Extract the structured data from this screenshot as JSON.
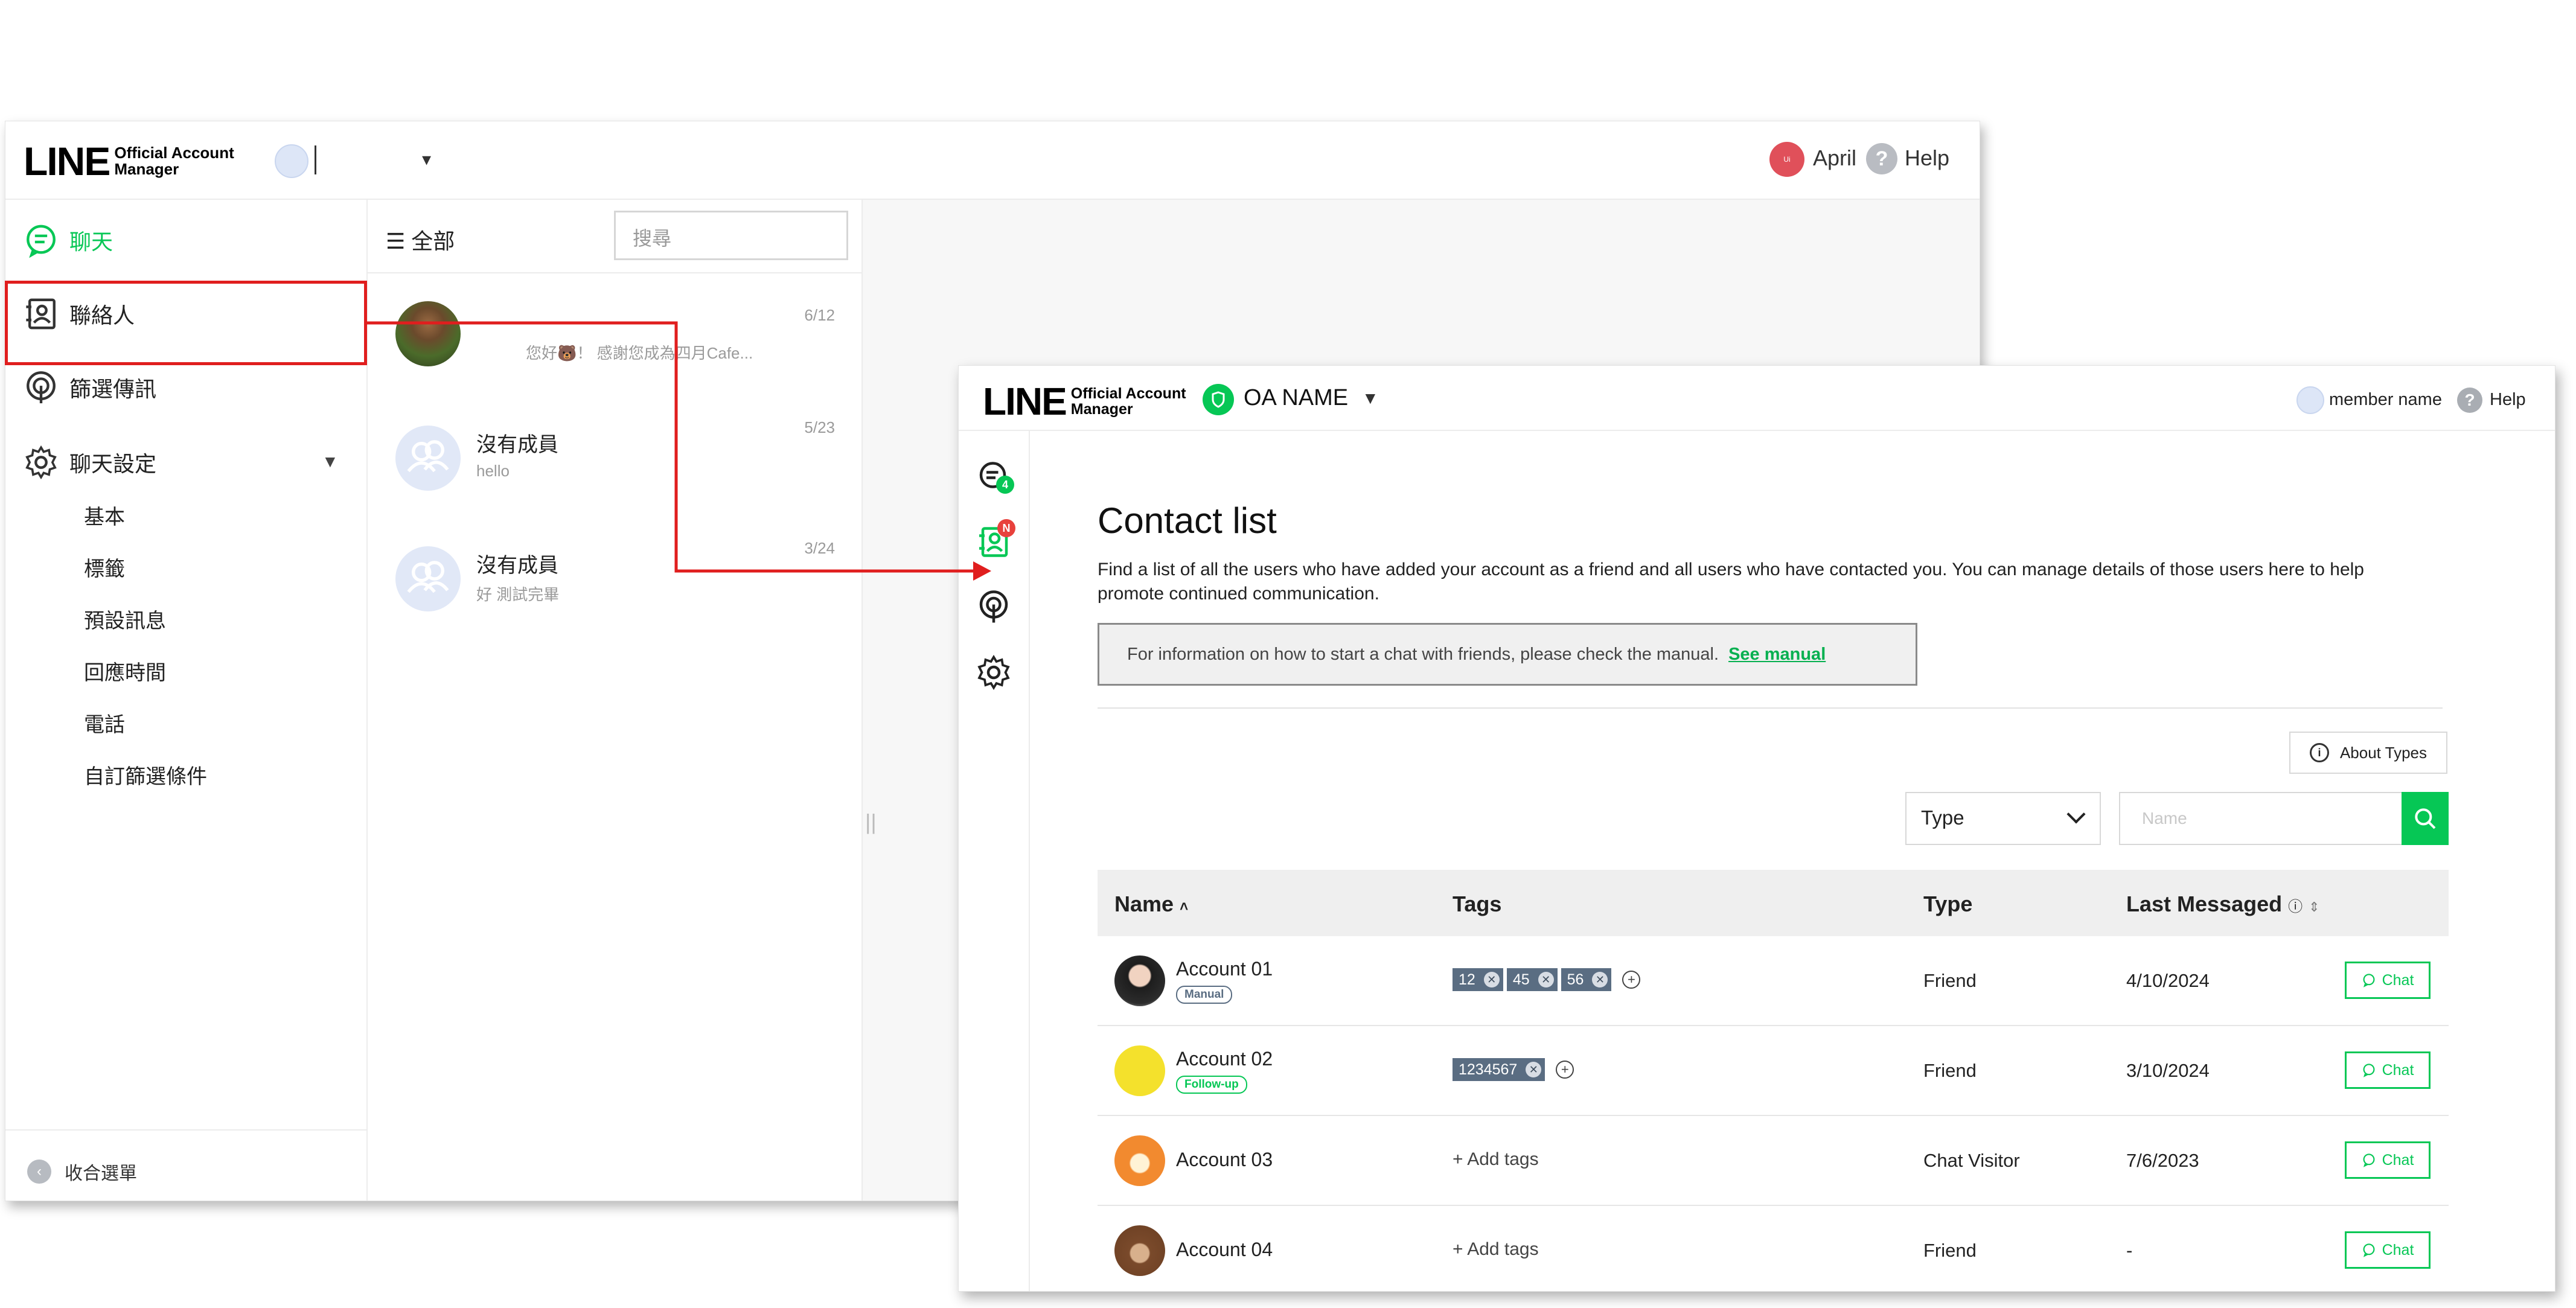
{
  "window1": {
    "logo": {
      "line": "LINE",
      "sub1": "Official Account",
      "sub2": "Manager"
    },
    "account": {
      "name": "|",
      "caret": "▾"
    },
    "user": {
      "avatar_text": "Ui",
      "name": "April"
    },
    "help": {
      "icon": "?",
      "label": "Help"
    },
    "sidebar": {
      "items": [
        {
          "label": "聊天",
          "icon": "chat-icon"
        },
        {
          "label": "聯絡人",
          "icon": "contacts-icon"
        },
        {
          "label": "篩選傳訊",
          "icon": "broadcast-icon"
        },
        {
          "label": "聊天設定",
          "icon": "gear-icon"
        }
      ],
      "sub_items": [
        "基本",
        "標籤",
        "預設訊息",
        "回應時間",
        "電話",
        "自訂篩選條件"
      ],
      "collapse_label": "收合選單"
    },
    "list": {
      "filter_label": "☰  全部",
      "search_placeholder": "搜尋",
      "chats": [
        {
          "name": "",
          "preview": "您好🐻！ 感謝您成為四月Cafe...",
          "date": "6/12"
        },
        {
          "name": "沒有成員",
          "preview": "hello",
          "date": "5/23"
        },
        {
          "name": "沒有成員",
          "preview": "好 測試完畢",
          "date": "3/24"
        }
      ]
    },
    "splitter": "||"
  },
  "window2": {
    "logo": {
      "line": "LINE",
      "sub1": "Official Account",
      "sub2": "Manager"
    },
    "oa_name": "OA NAME",
    "member_name": "member name",
    "help": {
      "icon": "?",
      "label": "Help"
    },
    "rail": {
      "chat_badge": "4",
      "contacts_badge": "N"
    },
    "title": "Contact list",
    "description": "Find a list of all the users who have added your account as a friend and all users who have contacted you. You can manage details of those users here to help promote continued communication.",
    "notice": {
      "text": "For information on how to start a chat with friends, please check the manual.",
      "link": "See manual"
    },
    "about_types": "About Types",
    "type_select": "Type",
    "name_placeholder": "Name",
    "columns": {
      "name": "Name",
      "tags": "Tags",
      "type": "Type",
      "last_messaged": "Last Messaged"
    },
    "sort": {
      "name": "˄",
      "last_messaged": "⇕"
    },
    "add_tags_label": "+ Add tags",
    "chat_label": "Chat",
    "rows": [
      {
        "name": "Account 01",
        "badge": "Manual",
        "tags": [
          "12",
          "45",
          "56"
        ],
        "type": "Friend",
        "last": "4/10/2024"
      },
      {
        "name": "Account 02",
        "badge": "Follow-up",
        "tags": [
          "1234567"
        ],
        "type": "Friend",
        "last": "3/10/2024"
      },
      {
        "name": "Account 03",
        "badge": "",
        "tags": [],
        "type": "Chat Visitor",
        "last": "7/6/2023"
      },
      {
        "name": "Account 04",
        "badge": "",
        "tags": [],
        "type": "Friend",
        "last": "-"
      }
    ]
  },
  "colors": {
    "line_green": "#06c755",
    "highlight_red": "#e01e1e",
    "tag_chip": "#5a6d82"
  }
}
